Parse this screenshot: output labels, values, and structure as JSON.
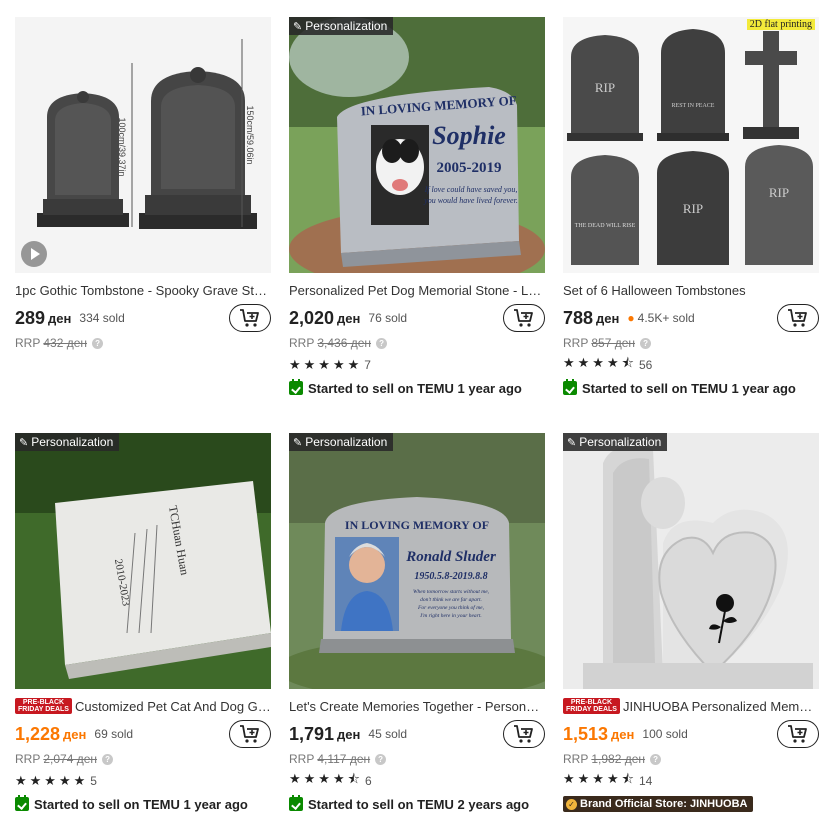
{
  "products": [
    {
      "title": "1pc Gothic Tombstone - Spooky Grave Sto...",
      "price": "289",
      "currency": "ден",
      "sold": "334 sold",
      "rrp_label": "RRP",
      "rrp": "432 ден",
      "image_text": [
        "100cm/39.37in",
        "150cm/59.06in"
      ]
    },
    {
      "personalization": "Personalization",
      "title": "Personalized Pet Dog Memorial Stone - Lar...",
      "price": "2,020",
      "currency": "ден",
      "sold": "76 sold",
      "rrp_label": "RRP",
      "rrp": "3,436 ден",
      "stars": "★★★★★",
      "rating_count": "7",
      "rating_value": 5,
      "badge": "Started to sell on TEMU 1 year ago",
      "image_text": [
        "IN LOVING MEMORY OF",
        "Sophie",
        "2005-2019",
        "If love could have saved you,",
        "you would have lived forever."
      ]
    },
    {
      "title": "Set of 6 Halloween Tombstones",
      "price": "788",
      "currency": "ден",
      "sold": "4.5K+ sold",
      "rrp_label": "RRP",
      "rrp": "857 ден",
      "stars": "★★★★⯪",
      "rating_count": "56",
      "rating_value": 4.5,
      "badge": "Started to sell on TEMU 1 year ago",
      "corner_tag": "2D flat printing",
      "image_text": [
        "RIP",
        "REST IN PEACE",
        "RIP",
        "THE DEAD WILL RISE",
        "RIP"
      ]
    },
    {
      "personalization": "Personalization",
      "deal": [
        "PRE-BLACK",
        "FRIDAY DEALS"
      ],
      "title": "Customized Pet Cat And Dog Gar...",
      "price": "1,228",
      "currency": "ден",
      "sold": "69 sold",
      "rrp_label": "RRP",
      "rrp": "2,074 ден",
      "stars": "★★★★★",
      "rating_count": "5",
      "rating_value": 5,
      "badge": "Started to sell on TEMU 1 year ago",
      "image_text": [
        "TCHuan Huan",
        "2010-2023"
      ]
    },
    {
      "personalization": "Personalization",
      "title": "Let's Create Memories Together - Personali...",
      "price": "1,791",
      "currency": "ден",
      "sold": "45 sold",
      "rrp_label": "RRP",
      "rrp": "4,117 ден",
      "stars": "★★★★⯪",
      "rating_count": "6",
      "rating_value": 4.5,
      "badge": "Started to sell on TEMU 2 years ago",
      "image_text": [
        "IN LOVING MEMORY OF",
        "Ronald Sluder",
        "1950.5.8-2019.8.8",
        "When tomorrow starts without me,",
        "don't think we are far apart.",
        "For everyone you think of me,",
        "I'm right here in your heart."
      ]
    },
    {
      "personalization": "Personalization",
      "deal": [
        "PRE-BLACK",
        "FRIDAY DEALS"
      ],
      "title": "JINHUOBA Personalized Memorial...",
      "price": "1,513",
      "currency": "ден",
      "sold": "100 sold",
      "rrp_label": "RRP",
      "rrp": "1,982 ден",
      "stars": "★★★★⯪",
      "rating_count": "14",
      "rating_value": 4.5,
      "brand": "Brand Official Store: JINHUOBA"
    }
  ],
  "colors": {
    "deal_price": "#fb7701",
    "badge_green": "#0a8a00",
    "deal_red": "#c71820"
  },
  "icons": {
    "cart": "add-to-cart-icon",
    "personalization": "pen-icon",
    "help": "help-icon",
    "video": "play-icon"
  }
}
